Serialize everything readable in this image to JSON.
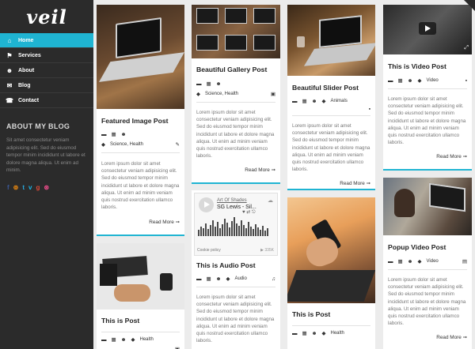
{
  "sidebar": {
    "logo": "veil",
    "nav": [
      {
        "label": "Home",
        "icon": "home-icon",
        "glyph": "⌂",
        "active": true
      },
      {
        "label": "Services",
        "icon": "flag-icon",
        "glyph": "⚑",
        "active": false
      },
      {
        "label": "About",
        "icon": "user-icon",
        "glyph": "☻",
        "active": false
      },
      {
        "label": "Blog",
        "icon": "chat-icon",
        "glyph": "✉",
        "active": false
      },
      {
        "label": "Contact",
        "icon": "phone-icon",
        "glyph": "☎",
        "active": false
      }
    ],
    "about_title": "ABOUT MY BLOG",
    "about_text": "Sit amet consectetur veniam adipisicing elit. Sed do eiusmod tempor minim incididunt ut labore et dolore magna aliqua. Ut enim ad minim.",
    "social": [
      {
        "icon": "facebook-icon",
        "glyph": "f",
        "color": "#3b5998"
      },
      {
        "icon": "rss-icon",
        "glyph": "⊚",
        "color": "#f28c0f"
      },
      {
        "icon": "twitter-icon",
        "glyph": "t",
        "color": "#2aa9e0"
      },
      {
        "icon": "vimeo-icon",
        "glyph": "v",
        "color": "#1ab7ea"
      },
      {
        "icon": "google-plus-icon",
        "glyph": "g",
        "color": "#dd4b39"
      },
      {
        "icon": "dribbble-icon",
        "glyph": "⊛",
        "color": "#ea4c89"
      }
    ]
  },
  "excerpt": "Lorem ipsum dolor sit amet consectetur veniam adipisicing elit. Sed do eiusmod tempor minim incididunt ut labore et dolore magna aliqua. Ut enim ad minim veniam quis nostrud exercitation ullamco laboris.",
  "read_more": "Read More ➞",
  "posts": {
    "featured": {
      "title": "Featured Image Post",
      "tags": "Science, Health"
    },
    "gallery": {
      "title": "Beautiful Gallery Post",
      "tags": "Science, Health"
    },
    "slider": {
      "title": "Beautiful Slider Post",
      "tags": "Animals"
    },
    "video": {
      "title": "This is Video Post",
      "tags": "Video"
    },
    "audio": {
      "title": "This is Audio Post",
      "tags": "Audio",
      "artist": "Art Of Shades",
      "track": "SG Lewis - Sil...",
      "plays": "▶ 335K",
      "cookie": "Cookie policy"
    },
    "this_post": {
      "title": "This is Post",
      "tags": "Health"
    },
    "post2": {
      "title": "This is Post",
      "tags": "Health"
    },
    "popup": {
      "title": "Popup Video Post",
      "tags": "Video"
    }
  }
}
